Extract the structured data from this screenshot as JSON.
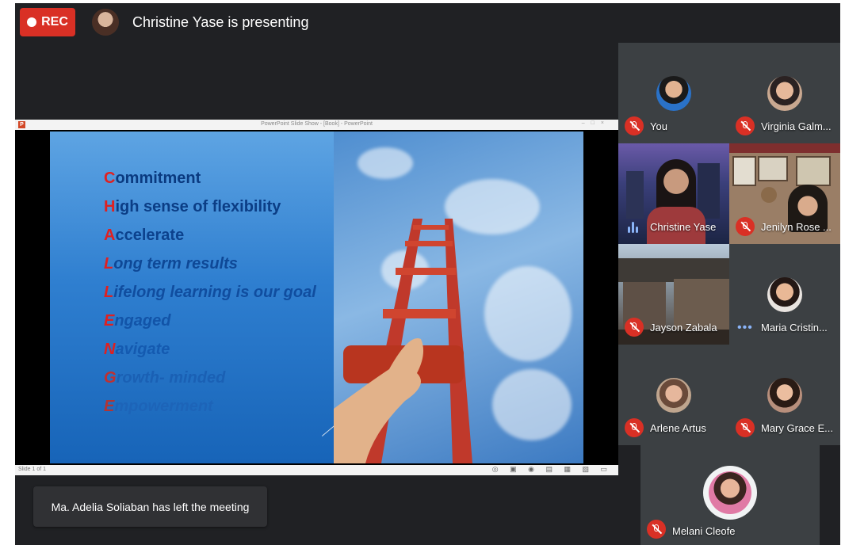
{
  "meeting": {
    "rec_label": "REC",
    "presenter_text": "Christine Yase is presenting",
    "toast": "Ma. Adelia Soliaban has left the meeting"
  },
  "powerpoint": {
    "window_title": "PowerPoint Slide Show - [Book] - PowerPoint",
    "status_left": "Slide 1 of 1"
  },
  "slide": {
    "words": [
      {
        "first": "C",
        "rest": "ommitment"
      },
      {
        "first": "H",
        "rest": "igh sense of flexibility"
      },
      {
        "first": "A",
        "rest": "ccelerate"
      },
      {
        "first": "L",
        "rest": "ong term results"
      },
      {
        "first": "L",
        "rest": "ifelong learning is our goal"
      },
      {
        "first": "E",
        "rest": "ngaged"
      },
      {
        "first": "N",
        "rest": "avigate"
      },
      {
        "first": "G",
        "rest": "rowth- minded"
      },
      {
        "first": "E",
        "rest": "mpowerment"
      }
    ]
  },
  "participants": [
    {
      "name": "You",
      "status": "muted"
    },
    {
      "name": "Virginia Galm...",
      "status": "muted"
    },
    {
      "name": "Christine Yase",
      "status": "speaking"
    },
    {
      "name": "Jenilyn Rose ...",
      "status": "muted"
    },
    {
      "name": "Jayson Zabala",
      "status": "muted"
    },
    {
      "name": "Maria Cristin...",
      "status": "idle"
    },
    {
      "name": "Arlene Artus",
      "status": "muted"
    },
    {
      "name": "Mary Grace E...",
      "status": "muted"
    },
    {
      "name": "Melani Cleofe",
      "status": "muted"
    }
  ],
  "colors": {
    "meet_bg": "#202124",
    "rec_red": "#d93025",
    "letter_red": "#e02020",
    "speaking_blue": "#8ab4f8"
  }
}
